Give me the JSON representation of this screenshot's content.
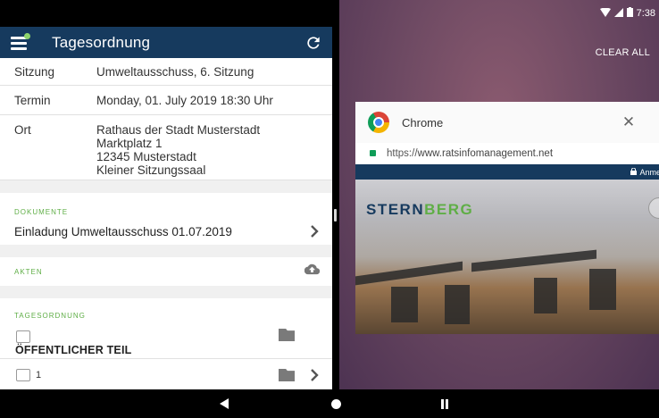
{
  "app": {
    "title": "Tagesordnung",
    "accent_color": "#163a5e",
    "section_color": "#5fae46"
  },
  "details": {
    "sitzung_label": "Sitzung",
    "sitzung_value": "Umweltausschuss, 6. Sitzung",
    "termin_label": "Termin",
    "termin_value": "Monday, 01. July 2019 18:30 Uhr",
    "ort_label": "Ort",
    "ort_lines": [
      "Rathaus der Stadt Musterstadt",
      "Marktplatz 1",
      "12345 Musterstadt",
      "Kleiner Sitzungssaal"
    ]
  },
  "sections": {
    "dokumente_label": "DOKUMENTE",
    "dokument_item": "Einladung Umweltausschuss 01.07.2019",
    "akten_label": "AKTEN",
    "tagesordnung_label": "TAGESORDNUNG",
    "item_title": "ÖFFENTLICHER TEIL",
    "sub_item_number": "1"
  },
  "icons": {
    "menu": "hamburger-menu-icon",
    "refresh": "refresh-icon",
    "chevron": "chevron-right-icon",
    "cloud": "cloud-upload-icon",
    "folder": "folder-icon",
    "comment": "comment-icon"
  },
  "status_bar": {
    "time": "7:38"
  },
  "overview": {
    "clear_all": "CLEAR ALL",
    "card_title": "Chrome",
    "url_scheme": "https://",
    "url_host": "www.ratsinfomanagement.net",
    "site_login": "Anme",
    "logo_part_a": "STERN",
    "logo_part_b": "BERG"
  }
}
